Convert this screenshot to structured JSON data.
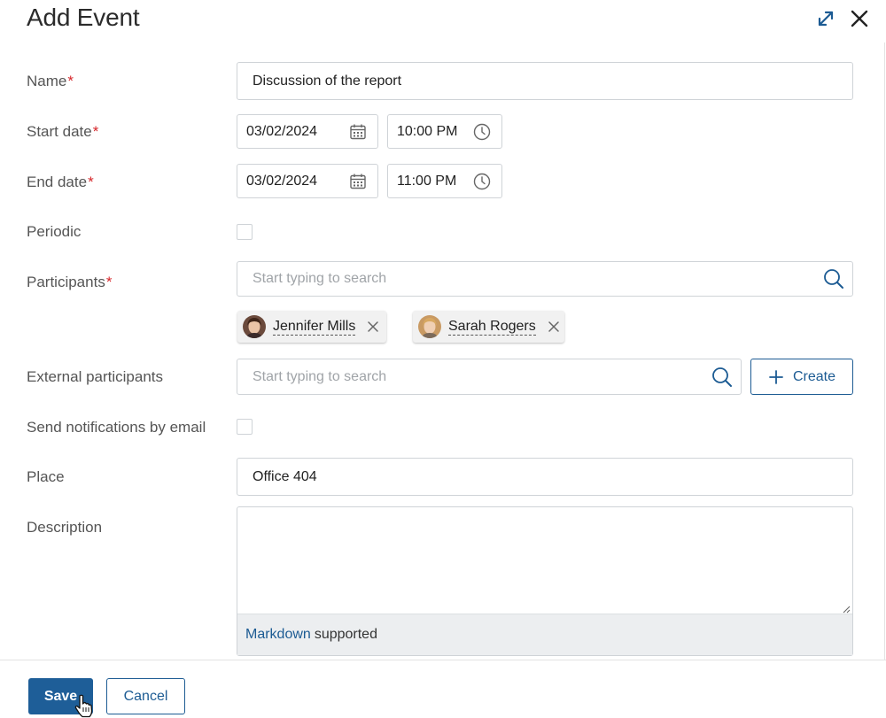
{
  "dialog": {
    "title": "Add Event",
    "expand_icon": "expand-icon",
    "close_icon": "close-icon"
  },
  "form": {
    "name": {
      "label": "Name",
      "required_mark": "*",
      "value": "Discussion of the report"
    },
    "start_date": {
      "label": "Start date",
      "required_mark": "*",
      "date": "03/02/2024",
      "time": "10:00 PM"
    },
    "end_date": {
      "label": "End date",
      "required_mark": "*",
      "date": "03/02/2024",
      "time": "11:00 PM"
    },
    "periodic": {
      "label": "Periodic",
      "checked": false
    },
    "participants": {
      "label": "Participants",
      "required_mark": "*",
      "placeholder": "Start typing to search",
      "chips": [
        {
          "name": "Jennifer Mills"
        },
        {
          "name": "Sarah Rogers"
        }
      ]
    },
    "external_participants": {
      "label": "External participants",
      "placeholder": "Start typing to search",
      "create_label": "Create"
    },
    "send_notifications": {
      "label": "Send notifications by email",
      "checked": false
    },
    "place": {
      "label": "Place",
      "value": "Office 404"
    },
    "description": {
      "label": "Description",
      "value": "",
      "markdown_link": "Markdown",
      "markdown_suffix": "supported"
    }
  },
  "footer": {
    "save_label": "Save",
    "cancel_label": "Cancel"
  },
  "colors": {
    "accent": "#1c5b93",
    "required": "#d6262a",
    "primary_button": "#1e5e98"
  }
}
